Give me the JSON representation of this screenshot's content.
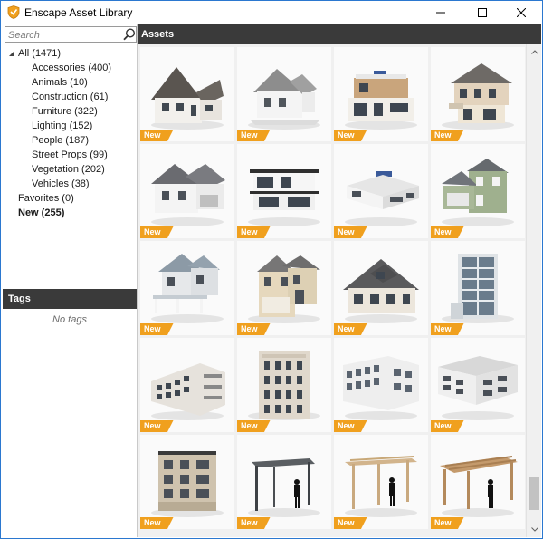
{
  "window": {
    "title": "Enscape Asset Library",
    "icons": {
      "app": "enscape-shield-icon",
      "minimize": "minimize-icon",
      "maximize": "maximize-icon",
      "close": "close-icon"
    }
  },
  "search": {
    "placeholder": "Search",
    "value": "",
    "icon": "search-icon"
  },
  "tree": {
    "root": "All (1471)",
    "categories": [
      "Accessories (400)",
      "Animals (10)",
      "Construction (61)",
      "Furniture (322)",
      "Lighting (152)",
      "People (187)",
      "Street Props (99)",
      "Vegetation (202)",
      "Vehicles (38)"
    ],
    "favorites": "Favorites (0)",
    "new": "New (255)"
  },
  "tags": {
    "header": "Tags",
    "empty_text": "No tags"
  },
  "assets": {
    "header": "Assets",
    "badge_label": "New",
    "badge_color": "#f0a01e",
    "tiles": [
      {
        "kind": "house-gable"
      },
      {
        "kind": "house-white"
      },
      {
        "kind": "modern-villa"
      },
      {
        "kind": "house-two-story"
      },
      {
        "kind": "house-gable-wide"
      },
      {
        "kind": "flat-modern"
      },
      {
        "kind": "flat-bungalow"
      },
      {
        "kind": "house-green"
      },
      {
        "kind": "house-porch"
      },
      {
        "kind": "house-beige"
      },
      {
        "kind": "house-dormer"
      },
      {
        "kind": "tower-glass"
      },
      {
        "kind": "apartment-balconies"
      },
      {
        "kind": "apartment-corner"
      },
      {
        "kind": "office-block"
      },
      {
        "kind": "warehouse"
      },
      {
        "kind": "apartment-small"
      },
      {
        "kind": "pergola-dark"
      },
      {
        "kind": "pergola-wood"
      },
      {
        "kind": "pergola-wood-large"
      }
    ]
  },
  "colors": {
    "header_bg": "#3a3a3a",
    "window_border": "#2b78d0",
    "selected_text": "#000000"
  }
}
